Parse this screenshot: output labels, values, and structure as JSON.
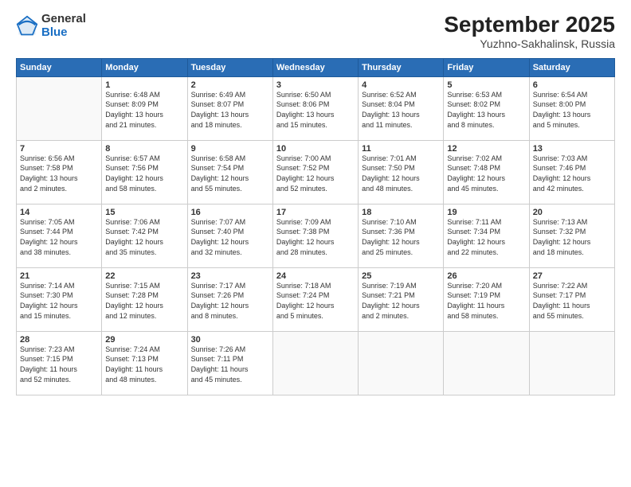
{
  "logo": {
    "general": "General",
    "blue": "Blue"
  },
  "header": {
    "month": "September 2025",
    "location": "Yuzhno-Sakhalinsk, Russia"
  },
  "weekdays": [
    "Sunday",
    "Monday",
    "Tuesday",
    "Wednesday",
    "Thursday",
    "Friday",
    "Saturday"
  ],
  "weeks": [
    [
      {
        "date": "",
        "info": ""
      },
      {
        "date": "1",
        "info": "Sunrise: 6:48 AM\nSunset: 8:09 PM\nDaylight: 13 hours\nand 21 minutes."
      },
      {
        "date": "2",
        "info": "Sunrise: 6:49 AM\nSunset: 8:07 PM\nDaylight: 13 hours\nand 18 minutes."
      },
      {
        "date": "3",
        "info": "Sunrise: 6:50 AM\nSunset: 8:06 PM\nDaylight: 13 hours\nand 15 minutes."
      },
      {
        "date": "4",
        "info": "Sunrise: 6:52 AM\nSunset: 8:04 PM\nDaylight: 13 hours\nand 11 minutes."
      },
      {
        "date": "5",
        "info": "Sunrise: 6:53 AM\nSunset: 8:02 PM\nDaylight: 13 hours\nand 8 minutes."
      },
      {
        "date": "6",
        "info": "Sunrise: 6:54 AM\nSunset: 8:00 PM\nDaylight: 13 hours\nand 5 minutes."
      }
    ],
    [
      {
        "date": "7",
        "info": "Sunrise: 6:56 AM\nSunset: 7:58 PM\nDaylight: 13 hours\nand 2 minutes."
      },
      {
        "date": "8",
        "info": "Sunrise: 6:57 AM\nSunset: 7:56 PM\nDaylight: 12 hours\nand 58 minutes."
      },
      {
        "date": "9",
        "info": "Sunrise: 6:58 AM\nSunset: 7:54 PM\nDaylight: 12 hours\nand 55 minutes."
      },
      {
        "date": "10",
        "info": "Sunrise: 7:00 AM\nSunset: 7:52 PM\nDaylight: 12 hours\nand 52 minutes."
      },
      {
        "date": "11",
        "info": "Sunrise: 7:01 AM\nSunset: 7:50 PM\nDaylight: 12 hours\nand 48 minutes."
      },
      {
        "date": "12",
        "info": "Sunrise: 7:02 AM\nSunset: 7:48 PM\nDaylight: 12 hours\nand 45 minutes."
      },
      {
        "date": "13",
        "info": "Sunrise: 7:03 AM\nSunset: 7:46 PM\nDaylight: 12 hours\nand 42 minutes."
      }
    ],
    [
      {
        "date": "14",
        "info": "Sunrise: 7:05 AM\nSunset: 7:44 PM\nDaylight: 12 hours\nand 38 minutes."
      },
      {
        "date": "15",
        "info": "Sunrise: 7:06 AM\nSunset: 7:42 PM\nDaylight: 12 hours\nand 35 minutes."
      },
      {
        "date": "16",
        "info": "Sunrise: 7:07 AM\nSunset: 7:40 PM\nDaylight: 12 hours\nand 32 minutes."
      },
      {
        "date": "17",
        "info": "Sunrise: 7:09 AM\nSunset: 7:38 PM\nDaylight: 12 hours\nand 28 minutes."
      },
      {
        "date": "18",
        "info": "Sunrise: 7:10 AM\nSunset: 7:36 PM\nDaylight: 12 hours\nand 25 minutes."
      },
      {
        "date": "19",
        "info": "Sunrise: 7:11 AM\nSunset: 7:34 PM\nDaylight: 12 hours\nand 22 minutes."
      },
      {
        "date": "20",
        "info": "Sunrise: 7:13 AM\nSunset: 7:32 PM\nDaylight: 12 hours\nand 18 minutes."
      }
    ],
    [
      {
        "date": "21",
        "info": "Sunrise: 7:14 AM\nSunset: 7:30 PM\nDaylight: 12 hours\nand 15 minutes."
      },
      {
        "date": "22",
        "info": "Sunrise: 7:15 AM\nSunset: 7:28 PM\nDaylight: 12 hours\nand 12 minutes."
      },
      {
        "date": "23",
        "info": "Sunrise: 7:17 AM\nSunset: 7:26 PM\nDaylight: 12 hours\nand 8 minutes."
      },
      {
        "date": "24",
        "info": "Sunrise: 7:18 AM\nSunset: 7:24 PM\nDaylight: 12 hours\nand 5 minutes."
      },
      {
        "date": "25",
        "info": "Sunrise: 7:19 AM\nSunset: 7:21 PM\nDaylight: 12 hours\nand 2 minutes."
      },
      {
        "date": "26",
        "info": "Sunrise: 7:20 AM\nSunset: 7:19 PM\nDaylight: 11 hours\nand 58 minutes."
      },
      {
        "date": "27",
        "info": "Sunrise: 7:22 AM\nSunset: 7:17 PM\nDaylight: 11 hours\nand 55 minutes."
      }
    ],
    [
      {
        "date": "28",
        "info": "Sunrise: 7:23 AM\nSunset: 7:15 PM\nDaylight: 11 hours\nand 52 minutes."
      },
      {
        "date": "29",
        "info": "Sunrise: 7:24 AM\nSunset: 7:13 PM\nDaylight: 11 hours\nand 48 minutes."
      },
      {
        "date": "30",
        "info": "Sunrise: 7:26 AM\nSunset: 7:11 PM\nDaylight: 11 hours\nand 45 minutes."
      },
      {
        "date": "",
        "info": ""
      },
      {
        "date": "",
        "info": ""
      },
      {
        "date": "",
        "info": ""
      },
      {
        "date": "",
        "info": ""
      }
    ]
  ]
}
